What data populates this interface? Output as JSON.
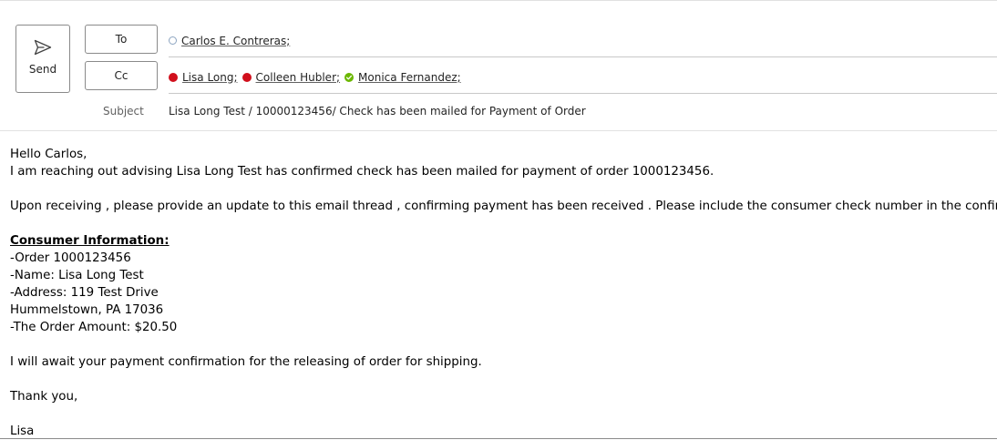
{
  "compose": {
    "send_label": "Send",
    "to_label": "To",
    "cc_label": "Cc",
    "subject_label": "Subject",
    "to_recipients": [
      {
        "name": "Carlos E. Contreras;",
        "status": "offline"
      }
    ],
    "cc_recipients": [
      {
        "name": "Lisa Long;",
        "status": "busy"
      },
      {
        "name": "Colleen Hubler;",
        "status": "busy"
      },
      {
        "name": "Monica Fernandez;",
        "status": "available"
      }
    ],
    "subject": "Lisa Long Test / 10000123456/ Check has been mailed for Payment of Order"
  },
  "colors": {
    "busy": "#d10f1c",
    "available": "#6bb700",
    "offline": "#8ca4c0"
  },
  "body": {
    "greeting": "Hello Carlos,",
    "intro": "I am reaching out advising Lisa Long Test has confirmed check has been mailed for payment of order 1000123456.",
    "request": "Upon receiving ,  please provide an update to this email thread , confirming payment has been received . Please include the consumer check number in the confirmation.",
    "info_heading": "Consumer Information:",
    "info_lines": [
      "-Order 1000123456",
      "-Name: Lisa Long Test",
      "-Address: 119 Test Drive",
      "Hummelstown, PA 17036",
      "-The Order Amount: $20.50"
    ],
    "closing_note": "I will await your payment confirmation for the releasing of order for shipping.",
    "sign_off": "Thank you,",
    "signature": "Lisa"
  }
}
